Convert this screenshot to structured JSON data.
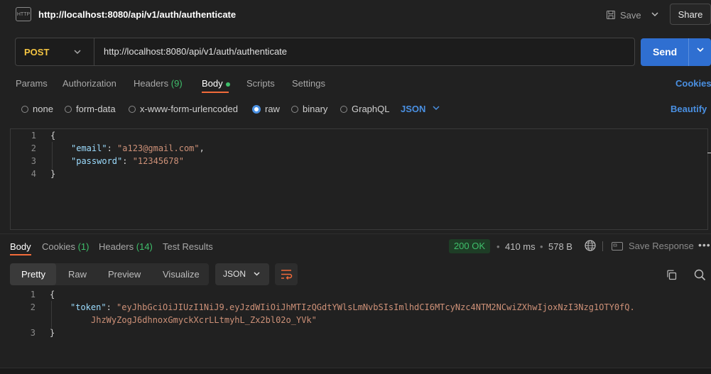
{
  "title_bar": {
    "icon_label": "HTTP",
    "url": "http://localhost:8080/api/v1/auth/authenticate",
    "save_label": "Save",
    "share_label": "Share"
  },
  "request": {
    "method": "POST",
    "url": "http://localhost:8080/api/v1/auth/authenticate",
    "send_label": "Send"
  },
  "request_tabs": {
    "params": "Params",
    "authorization": "Authorization",
    "headers": "Headers",
    "headers_count": "(9)",
    "body": "Body",
    "scripts": "Scripts",
    "settings": "Settings",
    "cookies": "Cookies"
  },
  "body_types": {
    "none": "none",
    "form_data": "form-data",
    "urlencoded": "x-www-form-urlencoded",
    "raw": "raw",
    "binary": "binary",
    "graphql": "GraphQL",
    "format": "JSON",
    "beautify": "Beautify",
    "selected": "raw"
  },
  "request_body_lines": {
    "n1": "1",
    "n2": "2",
    "n3": "3",
    "n4": "4",
    "l1": "{",
    "l2_key": "\"email\"",
    "l2_sep": ": ",
    "l2_val": "\"a123@gmail.com\"",
    "l2_end": ",",
    "l3_key": "\"password\"",
    "l3_sep": ": ",
    "l3_val": "\"12345678\"",
    "l4": "}"
  },
  "response_tabs": {
    "body": "Body",
    "cookies": "Cookies",
    "cookies_count": "(1)",
    "headers": "Headers",
    "headers_count": "(14)",
    "tests": "Test Results"
  },
  "response_meta": {
    "status": "200 OK",
    "time": "410 ms",
    "size": "578 B",
    "save_response": "Save Response"
  },
  "response_view": {
    "pretty": "Pretty",
    "raw": "Raw",
    "preview": "Preview",
    "visualize": "Visualize",
    "format": "JSON"
  },
  "response_body_lines": {
    "n1": "1",
    "n2": "2",
    "n3": "3",
    "l1": "{",
    "l2_key": "\"token\"",
    "l2_sep": ": ",
    "l2_val_a": "\"eyJhbGciOiJIUzI1NiJ9.eyJzdWIiOiJhMTIzQGdtYWlsLmNvbSIsImlhdCI6MTcyNzc4NTM2NCwiZXhwIjoxNzI3Nzg1OTY0fQ.",
    "l2_val_b": "JhzWyZogJ6dhnoxGmyckXcrLLtmyhL_Zx2bl02o_YVk\"",
    "l3": "}"
  },
  "colors": {
    "accent": "#f26b3a",
    "link": "#4a90e2",
    "success": "#3fbf6b",
    "method": "#f5c542",
    "send": "#2f6fd1"
  }
}
